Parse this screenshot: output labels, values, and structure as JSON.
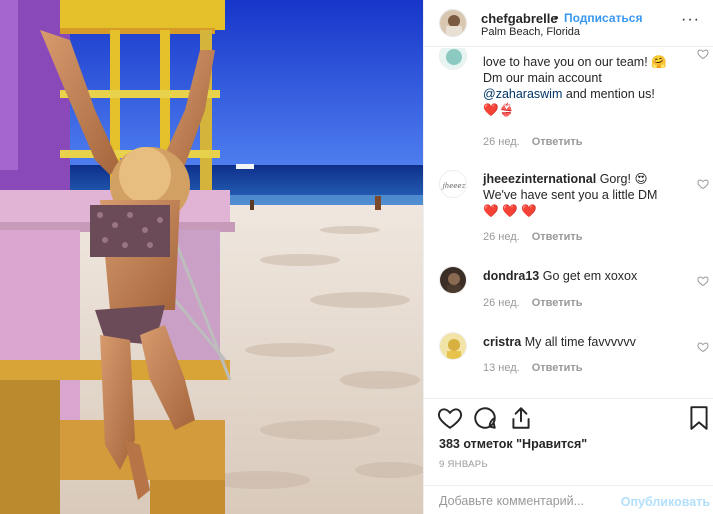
{
  "post": {
    "username": "chefgabrelle",
    "separator": "•",
    "follow_label": "Подписаться",
    "location": "Palm Beach, Florida",
    "more_label": "···"
  },
  "comments": [
    {
      "username": "",
      "line1": "love to have you on our team!",
      "line1_emoji": "🤗",
      "line2": "Dm our main account",
      "mention": "@zaharaswim",
      "line3_rest": " and mention us!",
      "line4": "❤️👙",
      "age": "26 нед.",
      "reply_label": "Ответить"
    },
    {
      "username": "jheeezinternational",
      "text1": " Gorg! 😍",
      "text2": "We've have sent you a little DM",
      "text3": "❤️ ❤️ ❤️",
      "age": "26 нед.",
      "reply_label": "Ответить"
    },
    {
      "username": "dondra13",
      "text1": " Go get em xoxox",
      "age": "26 нед.",
      "reply_label": "Ответить"
    },
    {
      "username": "cristra",
      "text1": " My all time favvvvvv",
      "age": "13 нед.",
      "reply_label": "Ответить"
    }
  ],
  "actions": {
    "likes_text": "383 отметок \"Нравится\"",
    "date_text": "9 ЯНВАРЬ",
    "comment_placeholder": "Добавьте комментарий...",
    "post_label": "Опубликовать"
  },
  "icons": [
    "heart-icon",
    "comment-icon",
    "share-icon",
    "bookmark-icon",
    "more-icon"
  ],
  "colors": {
    "link": "#3897f0",
    "mention": "#003569",
    "muted": "#999999",
    "post_disabled": "#b2dffc"
  }
}
